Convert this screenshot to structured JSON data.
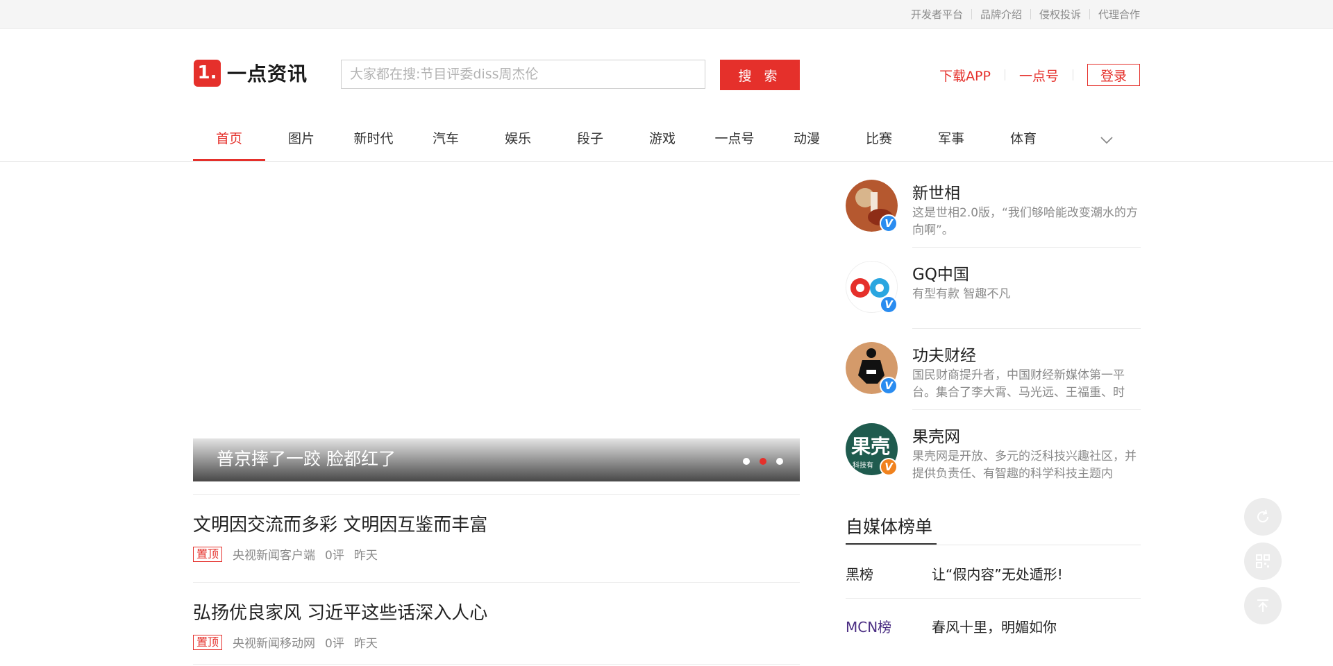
{
  "topbar": {
    "links": [
      "开发者平台",
      "品牌介绍",
      "侵权投诉",
      "代理合作"
    ]
  },
  "header": {
    "logo_mark": "1.",
    "logo_text": "一点资讯",
    "search_placeholder": "大家都在搜:节目评委diss周杰伦",
    "search_button": "搜 索",
    "download_app": "下载APP",
    "yidian_hao": "一点号",
    "login": "登录"
  },
  "nav": {
    "items": [
      "首页",
      "图片",
      "新时代",
      "汽车",
      "娱乐",
      "段子",
      "游戏",
      "一点号",
      "动漫",
      "比赛",
      "军事",
      "体育"
    ],
    "active_index": 0
  },
  "banner": {
    "caption": "普京摔了一跤 脸都红了",
    "slide_count": 3,
    "active_slide": 1
  },
  "articles": [
    {
      "title": "文明因交流而多彩 文明因互鉴而丰富",
      "tag": "置顶",
      "source": "央视新闻客户端",
      "comments": "0评",
      "time": "昨天"
    },
    {
      "title": "弘扬优良家风 习近平这些话深入人心",
      "tag": "置顶",
      "source": "央视新闻移动网",
      "comments": "0评",
      "time": "昨天"
    }
  ],
  "accounts": [
    {
      "name": "新世相",
      "desc": "这是世相2.0版，“我们够哈能改变潮水的方向啊”。",
      "badge": "V"
    },
    {
      "name": "GQ中国",
      "desc": "有型有款 智趣不凡",
      "badge": "V"
    },
    {
      "name": "功夫财经",
      "desc": "国民财商提升者，中国财经新媒体第一平台。集合了李大霄、马光远、王福重、时",
      "badge": "V"
    },
    {
      "name": "果壳网",
      "desc": "果壳网是开放、多元的泛科技兴趣社区，并提供负责任、有智趣的科学科技主题内",
      "badge": "V",
      "logo_text": "果壳",
      "logo_sub": "科技有"
    }
  ],
  "ranking": {
    "title": "自媒体榜单",
    "rows": [
      {
        "label": "黑榜",
        "text": "让“假内容”无处遁形!",
        "color": "#222222"
      },
      {
        "label": "MCN榜",
        "text": "春风十里，明媚如你",
        "color": "#4b2e83"
      }
    ]
  },
  "colors": {
    "accent": "#e5302b",
    "verified_blue": "#2a8cf0",
    "verified_orange": "#f0821e"
  }
}
